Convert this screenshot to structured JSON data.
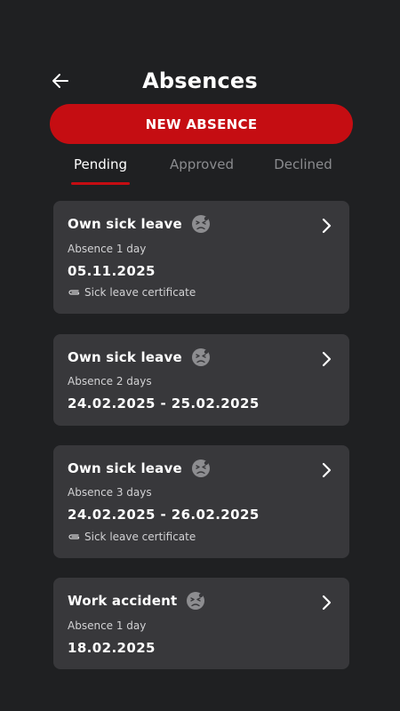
{
  "header": {
    "title": "Absences",
    "back_icon": "arrow-left-icon"
  },
  "actions": {
    "new_absence_label": "NEW ABSENCE"
  },
  "tabs": [
    {
      "label": "Pending",
      "active": true
    },
    {
      "label": "Approved",
      "active": false
    },
    {
      "label": "Declined",
      "active": false
    }
  ],
  "colors": {
    "accent": "#c50d12",
    "background": "#1f2022",
    "card": "#38383b",
    "muted": "#8a8b8e"
  },
  "absences": [
    {
      "type": "Own sick leave",
      "duration": "Absence 1 day",
      "dates": "05.11.2025",
      "attachment": "Sick leave certificate",
      "icon": "sick-face-icon"
    },
    {
      "type": "Own sick leave",
      "duration": "Absence 2 days",
      "dates": "24.02.2025 - 25.02.2025",
      "attachment": null,
      "icon": "sick-face-icon"
    },
    {
      "type": "Own sick leave",
      "duration": "Absence 3 days",
      "dates": "24.02.2025 - 26.02.2025",
      "attachment": "Sick leave certificate",
      "icon": "sick-face-icon"
    },
    {
      "type": "Work accident",
      "duration": "Absence 1 day",
      "dates": "18.02.2025",
      "attachment": null,
      "icon": "sick-face-icon"
    }
  ]
}
